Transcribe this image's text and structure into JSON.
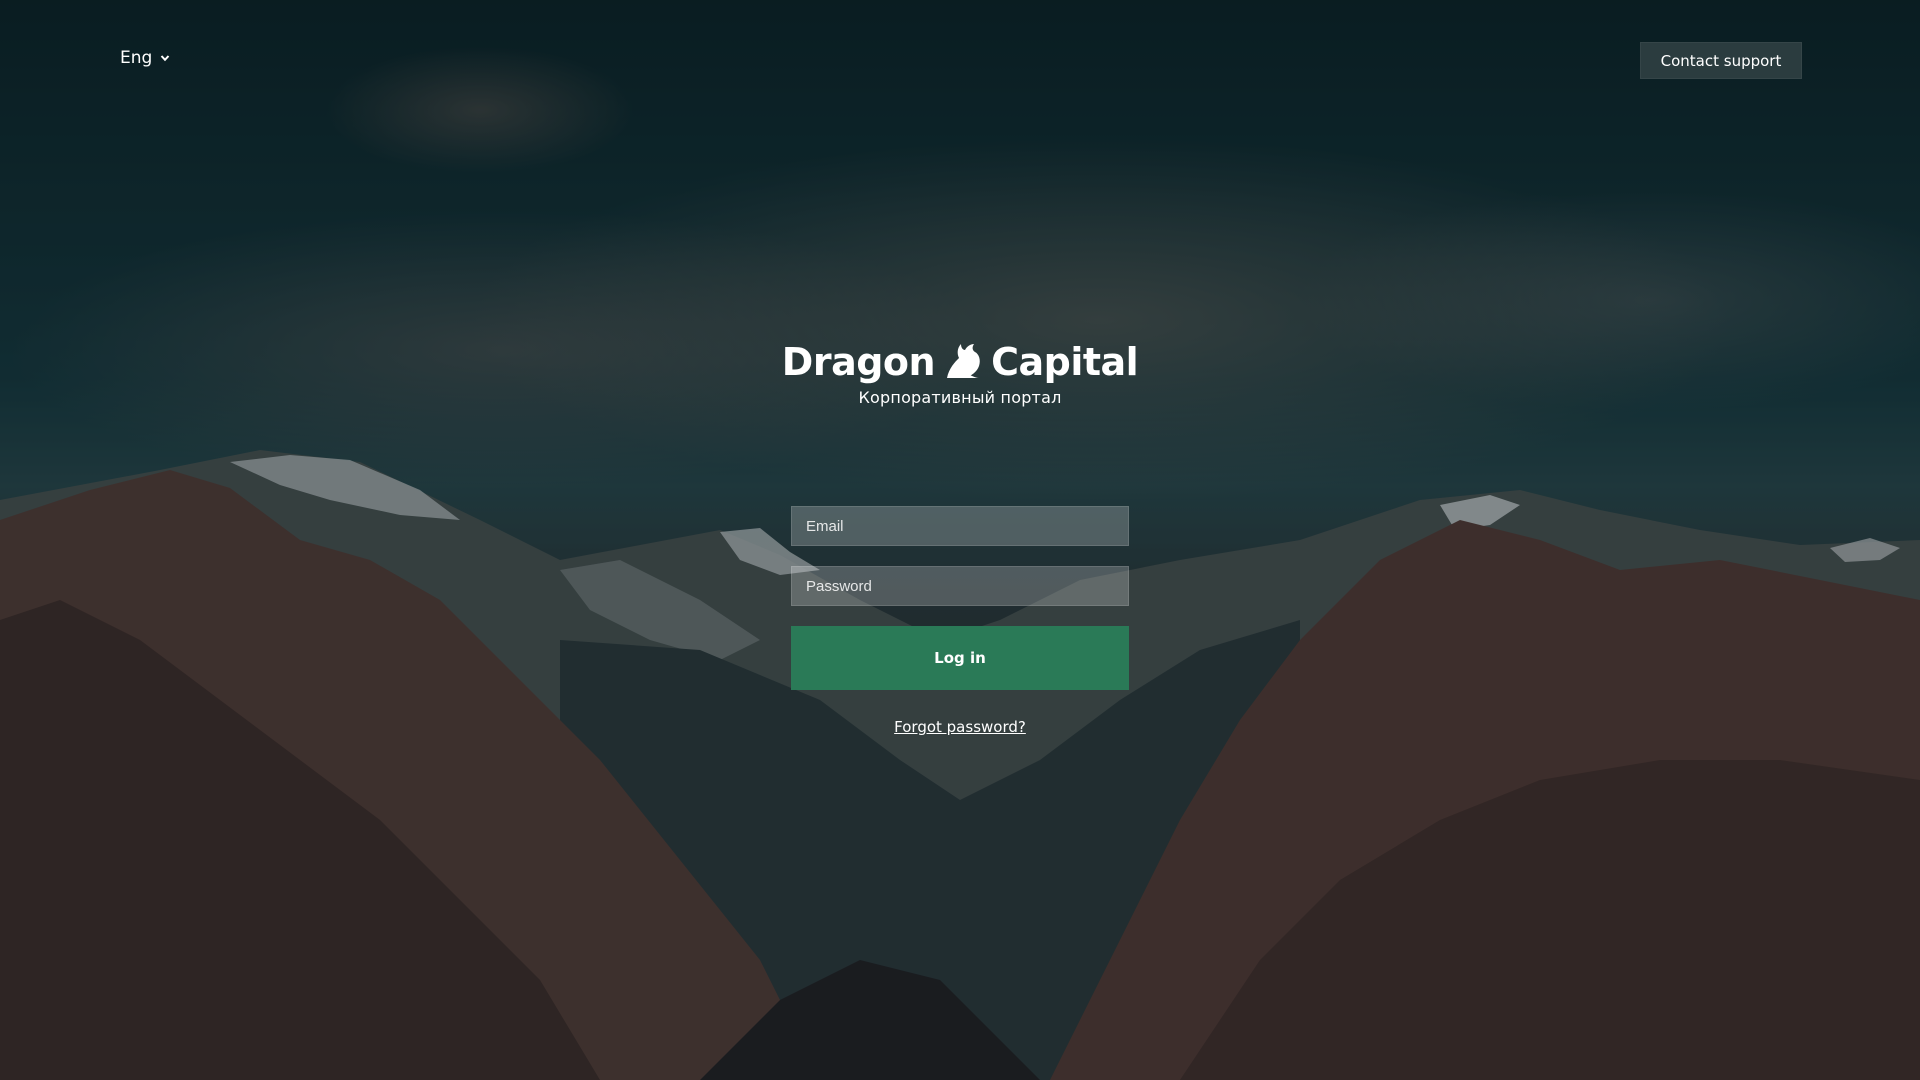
{
  "header": {
    "language": "Eng",
    "support_label": "Contact support"
  },
  "brand": {
    "name_left": "Dragon",
    "name_right": "Capital",
    "subtitle": "Корпоративный портал"
  },
  "form": {
    "email_placeholder": "Email",
    "password_placeholder": "Password",
    "login_label": "Log in",
    "forgot_label": "Forgot password?"
  },
  "colors": {
    "accent": "#2a7a57",
    "support_button": "#2b3c3f"
  },
  "icons": {
    "language_chevron": "chevron-down-icon",
    "logo_mark": "dragon-icon"
  }
}
